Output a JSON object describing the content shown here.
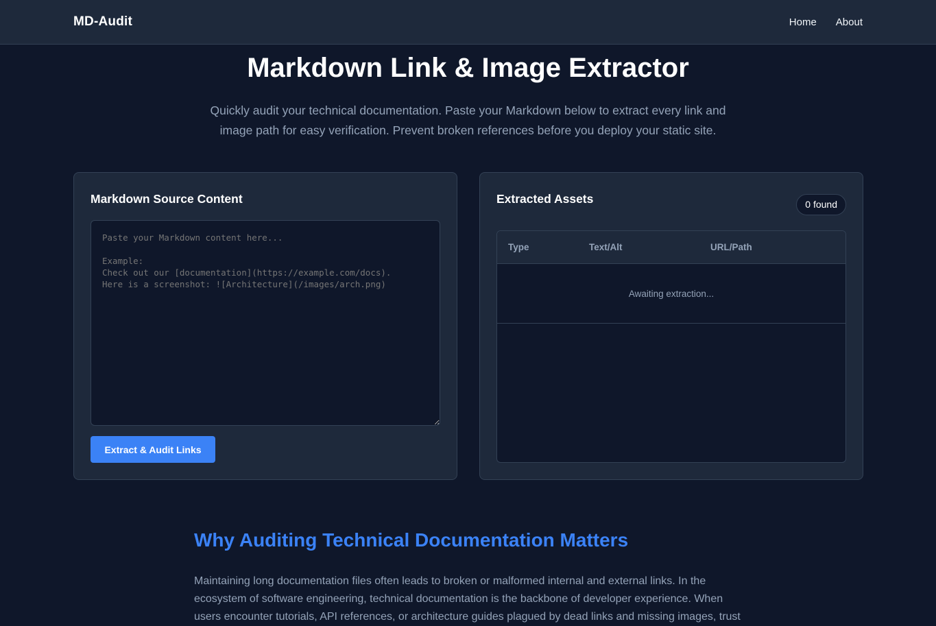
{
  "nav": {
    "brand": "MD-Audit",
    "links": [
      "Home",
      "About"
    ]
  },
  "hero": {
    "title": "Markdown Link & Image Extractor",
    "subtitle": "Quickly audit your technical documentation. Paste your Markdown below to extract every link and image path for easy verification. Prevent broken references before you deploy your static site."
  },
  "source_panel": {
    "title": "Markdown Source Content",
    "placeholder": "Paste your Markdown content here...\n\nExample:\nCheck out our [documentation](https://example.com/docs).\nHere is a screenshot: ![Architecture](/images/arch.png)",
    "button_label": "Extract & Audit Links"
  },
  "results_panel": {
    "title": "Extracted Assets",
    "count_badge": "0 found",
    "columns": [
      "Type",
      "Text/Alt",
      "URL/Path"
    ],
    "empty_message": "Awaiting extraction..."
  },
  "article": {
    "heading": "Why Auditing Technical Documentation Matters",
    "body": "Maintaining long documentation files often leads to broken or malformed internal and external links. In the ecosystem of software engineering, technical documentation is the backbone of developer experience. When users encounter tutorials, API references, or architecture guides plagued by dead links and missing images, trust"
  },
  "colors": {
    "background": "#0f172a",
    "panel": "#1e293b",
    "accent": "#3b82f6",
    "muted_text": "#94a3b8"
  }
}
